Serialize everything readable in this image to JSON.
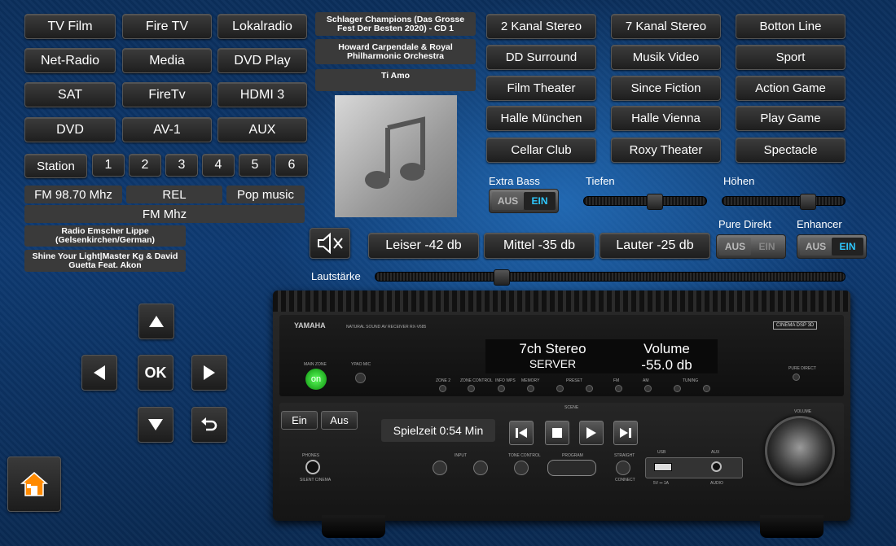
{
  "sources": [
    "TV Film",
    "Fire TV",
    "Lokalradio",
    "Net-Radio",
    "Media",
    "DVD Play",
    "SAT",
    "FireTv",
    "HDMI 3",
    "DVD",
    "AV-1",
    "AUX"
  ],
  "station": {
    "label": "Station",
    "presets": [
      "1",
      "2",
      "3",
      "4",
      "5",
      "6"
    ]
  },
  "radio": {
    "frequency": "FM 98.70 Mhz",
    "rel": "REL",
    "genre": "Pop music",
    "band": "FM Mhz",
    "station_name": "Radio Emscher Lippe (Gelsenkirchen/German)",
    "song": "Shine Your Light|Master Kg & David Guetta Feat. Akon"
  },
  "now_playing": {
    "album": "Schlager Champions (Das Grosse Fest Der Besten 2020) - CD 1",
    "artist": "Howard Carpendale & Royal Philharmonic Orchestra",
    "title": "Ti Amo"
  },
  "sound_modes": [
    "2 Kanal Stereo",
    "7 Kanal Stereo",
    "Botton Line",
    "DD Surround",
    "Musik Video",
    "Sport",
    "Film Theater",
    "Since Fiction",
    "Action Game",
    "Halle München",
    "Halle Vienna",
    "Play Game",
    "Cellar Club",
    "Roxy Theater",
    "Spectacle"
  ],
  "audio": {
    "extra_bass": "Extra Bass",
    "tiefen": "Tiefen",
    "hoehen": "Höhen",
    "pure_direkt": "Pure Direkt",
    "enhancer": "Enhancer",
    "off": "AUS",
    "on": "EIN",
    "tiefen_level": 0.58,
    "hoehen_level": 0.72
  },
  "volume": {
    "leiser": "Leiser -42 db",
    "mittel": "Mittel -35 db",
    "lauter": "Lauter -25 db",
    "label": "Lautstärke",
    "level": 0.26
  },
  "receiver": {
    "brand": "YAMAHA",
    "model": "NATURAL SOUND AV RECEIVER  RX-V685",
    "display_mode": "7ch Stereo",
    "display_source": "SERVER",
    "volume_label": "Volume",
    "volume_value": "-55.0 db",
    "power_on": "Ein",
    "power_off": "Aus",
    "power_indicator": "on",
    "playtime": "Spielzeit 0:54 Min",
    "main_zone": "MAIN ZONE",
    "pure_direct": "PURE DIRECT",
    "phones": "PHONES",
    "silent_cinema": "SILENT CINEMA",
    "input": "INPUT",
    "tone_control": "TONE CONTROL",
    "program": "PROGRAM",
    "straight": "STRAIGHT",
    "usb": "USB",
    "aux": "AUX",
    "scene": "SCENE",
    "volume_knob": "VOLUME",
    "cinema_dsp": "CINEMA DSP 3D",
    "yaudio": "YPAO MIC",
    "zone2": "ZONE 2",
    "zone_control": "ZONE CONTROL",
    "info": "INFO WPS",
    "memory": "MEMORY",
    "preset": "PRESET",
    "fm": "FM",
    "am": "AM",
    "tuning": "TUNING",
    "usb_spec": "5V ⎓ 1A",
    "audio_lbl": "AUDIO",
    "connect": "CONNECT"
  },
  "nav": {
    "ok": "OK"
  }
}
